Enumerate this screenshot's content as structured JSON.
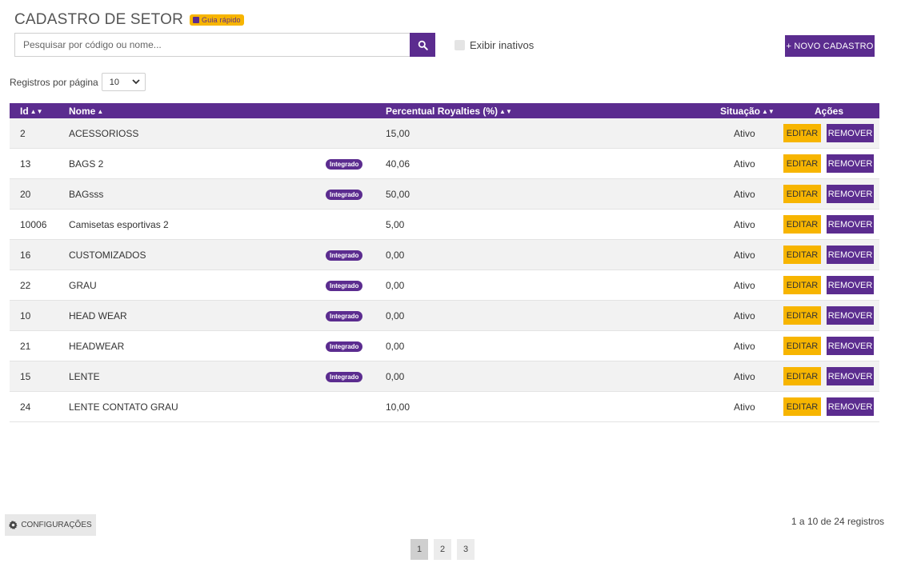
{
  "page": {
    "title": "CADASTRO DE SETOR",
    "guide_label": "Guia rápido"
  },
  "search": {
    "placeholder": "Pesquisar por código ou nome...",
    "value": ""
  },
  "filters": {
    "show_inactive_label": "Exibir inativos",
    "show_inactive_checked": false
  },
  "toolbar": {
    "new_label": "+ NOVO CADASTRO"
  },
  "pagination_size": {
    "label": "Registros por página",
    "value": "10"
  },
  "table": {
    "headers": {
      "id": "Id",
      "name": "Nome",
      "percent": "Percentual Royalties (%)",
      "status": "Situação",
      "actions": "Ações"
    },
    "integrated_badge": "Integrado",
    "edit_label": "EDITAR",
    "remove_label": "REMOVER",
    "rows": [
      {
        "id": "2",
        "name": "ACESSORIOSS",
        "integrado": false,
        "percent": "15,00",
        "status": "Ativo"
      },
      {
        "id": "13",
        "name": "BAGS 2",
        "integrado": true,
        "percent": "40,06",
        "status": "Ativo"
      },
      {
        "id": "20",
        "name": "BAGsss",
        "integrado": true,
        "percent": "50,00",
        "status": "Ativo"
      },
      {
        "id": "10006",
        "name": "Camisetas esportivas 2",
        "integrado": false,
        "percent": "5,00",
        "status": "Ativo"
      },
      {
        "id": "16",
        "name": "CUSTOMIZADOS",
        "integrado": true,
        "percent": "0,00",
        "status": "Ativo"
      },
      {
        "id": "22",
        "name": "GRAU",
        "integrado": true,
        "percent": "0,00",
        "status": "Ativo"
      },
      {
        "id": "10",
        "name": "HEAD WEAR",
        "integrado": true,
        "percent": "0,00",
        "status": "Ativo"
      },
      {
        "id": "21",
        "name": "HEADWEAR",
        "integrado": true,
        "percent": "0,00",
        "status": "Ativo"
      },
      {
        "id": "15",
        "name": "LENTE",
        "integrado": true,
        "percent": "0,00",
        "status": "Ativo"
      },
      {
        "id": "24",
        "name": "LENTE CONTATO GRAU",
        "integrado": false,
        "percent": "10,00",
        "status": "Ativo"
      }
    ]
  },
  "footer": {
    "config_label": "CONFIGURAÇÕES",
    "records_info": "1 a 10 de 24 registros",
    "pages": [
      "1",
      "2",
      "3"
    ],
    "current_page": "1"
  },
  "colors": {
    "primary": "#5b2c8f",
    "accent": "#f7b500",
    "row_alt": "#f2f2f2"
  }
}
